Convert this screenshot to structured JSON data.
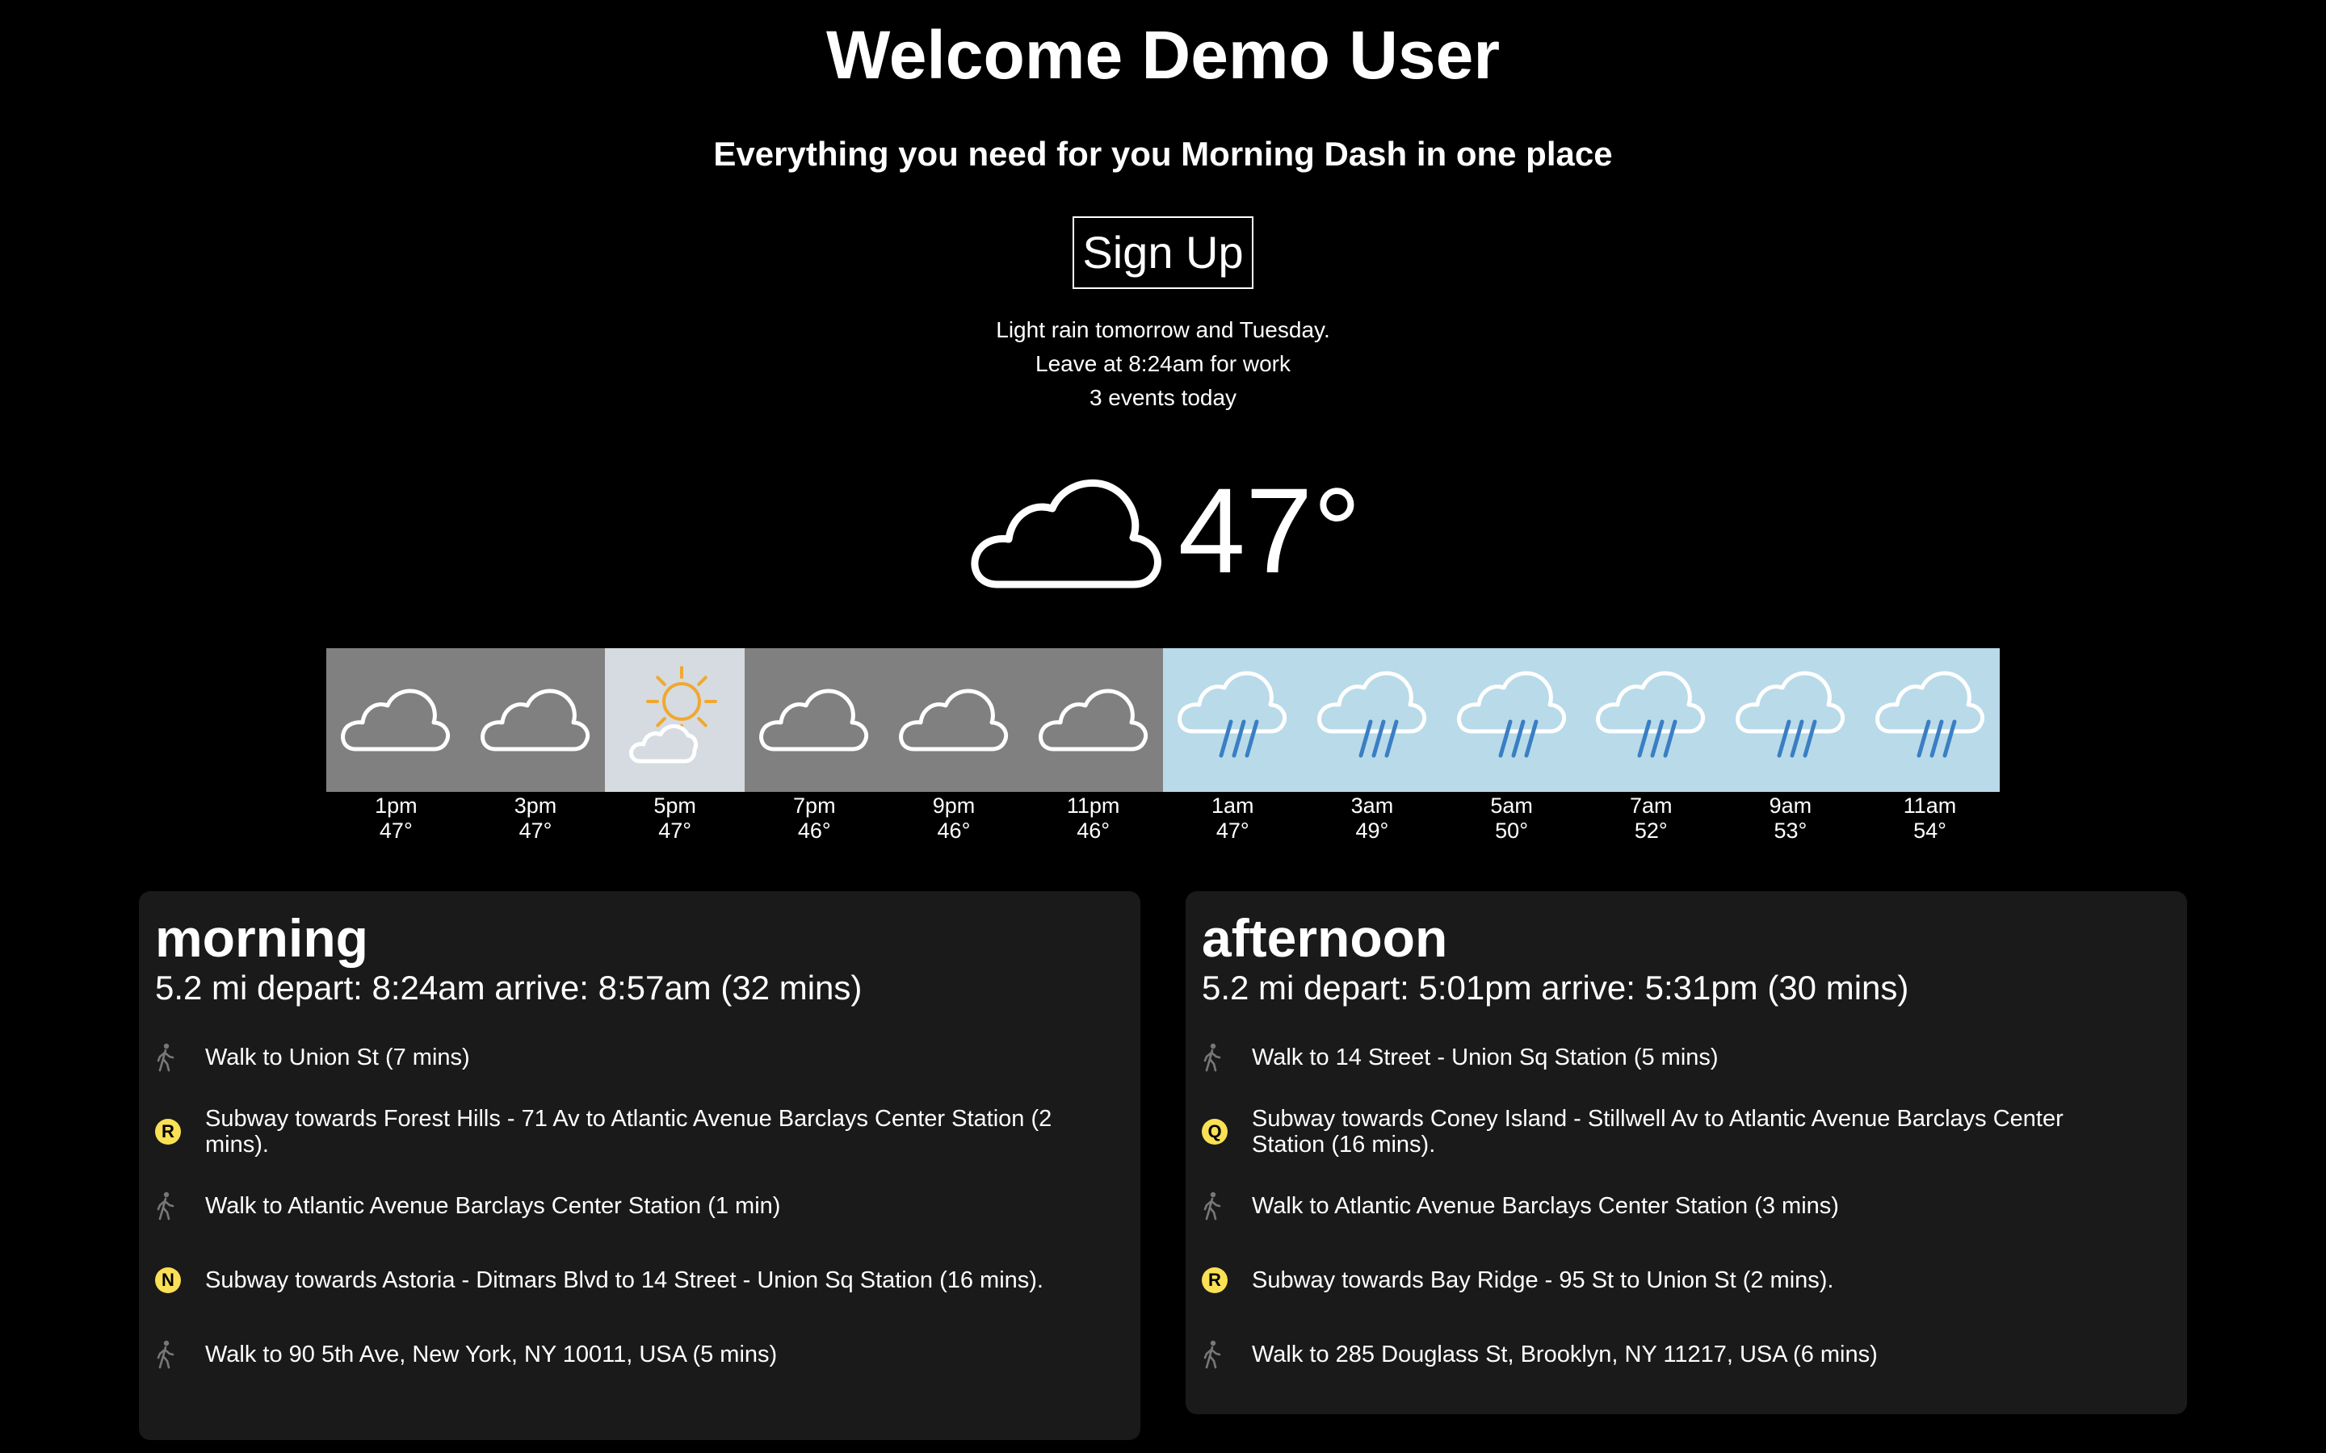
{
  "header": {
    "title": "Welcome Demo User",
    "subtitle": "Everything you need for you Morning Dash in one place",
    "signup_label": "Sign Up"
  },
  "summary": {
    "line1": "Light rain tomorrow and Tuesday.",
    "line2": "Leave at 8:24am for work",
    "line3": "3 events today"
  },
  "current": {
    "icon": "cloud-icon",
    "temp": "47°"
  },
  "hourly": [
    {
      "time": "1pm",
      "temp": "47°",
      "icon": "cloud-icon",
      "condition": "cloudy"
    },
    {
      "time": "3pm",
      "temp": "47°",
      "icon": "cloud-icon",
      "condition": "cloudy"
    },
    {
      "time": "5pm",
      "temp": "47°",
      "icon": "partly-sunny-icon",
      "condition": "sunny"
    },
    {
      "time": "7pm",
      "temp": "46°",
      "icon": "cloud-icon",
      "condition": "cloudy"
    },
    {
      "time": "9pm",
      "temp": "46°",
      "icon": "cloud-icon",
      "condition": "cloudy"
    },
    {
      "time": "11pm",
      "temp": "46°",
      "icon": "cloud-icon",
      "condition": "cloudy"
    },
    {
      "time": "1am",
      "temp": "47°",
      "icon": "rain-icon",
      "condition": "rain"
    },
    {
      "time": "3am",
      "temp": "49°",
      "icon": "rain-icon",
      "condition": "rain"
    },
    {
      "time": "5am",
      "temp": "50°",
      "icon": "rain-icon",
      "condition": "rain"
    },
    {
      "time": "7am",
      "temp": "52°",
      "icon": "rain-icon",
      "condition": "rain"
    },
    {
      "time": "9am",
      "temp": "53°",
      "icon": "rain-icon",
      "condition": "rain"
    },
    {
      "time": "11am",
      "temp": "54°",
      "icon": "rain-icon",
      "condition": "rain"
    }
  ],
  "colors": {
    "cloudy_bg": "#808080",
    "sunny_bg": "#d6dbe2",
    "rain_bg": "#b9dae8",
    "rain_drop": "#3a7fc4",
    "sun": "#f0a830",
    "subway_badge": "#f9e055",
    "panel_bg": "#1a1a1a"
  },
  "morning": {
    "title": "morning",
    "summary": "5.2 mi depart: 8:24am arrive: 8:57am (32 mins)",
    "steps": [
      {
        "type": "walk",
        "icon": "walking-person-icon",
        "text": "Walk to Union St (7 mins)"
      },
      {
        "type": "subway",
        "line": "R",
        "text": "Subway towards Forest Hills - 71 Av to Atlantic Avenue Barclays Center Station (2 mins)."
      },
      {
        "type": "walk",
        "icon": "walking-person-icon",
        "text": "Walk to Atlantic Avenue Barclays Center Station (1 min)"
      },
      {
        "type": "subway",
        "line": "N",
        "text": "Subway towards Astoria - Ditmars Blvd to 14 Street - Union Sq Station (16 mins)."
      },
      {
        "type": "walk",
        "icon": "walking-person-icon",
        "text": "Walk to 90 5th Ave, New York, NY 10011, USA (5 mins)"
      }
    ]
  },
  "afternoon": {
    "title": "afternoon",
    "summary": "5.2 mi depart: 5:01pm arrive: 5:31pm (30 mins)",
    "steps": [
      {
        "type": "walk",
        "icon": "walking-person-icon",
        "text": "Walk to 14 Street - Union Sq Station (5 mins)"
      },
      {
        "type": "subway",
        "line": "Q",
        "text": "Subway towards Coney Island - Stillwell Av to Atlantic Avenue Barclays Center Station (16 mins)."
      },
      {
        "type": "walk",
        "icon": "walking-person-icon",
        "text": "Walk to Atlantic Avenue Barclays Center Station (3 mins)"
      },
      {
        "type": "subway",
        "line": "R",
        "text": "Subway towards Bay Ridge - 95 St to Union St (2 mins)."
      },
      {
        "type": "walk",
        "icon": "walking-person-icon",
        "text": "Walk to 285 Douglass St, Brooklyn, NY 11217, USA (6 mins)"
      }
    ]
  }
}
